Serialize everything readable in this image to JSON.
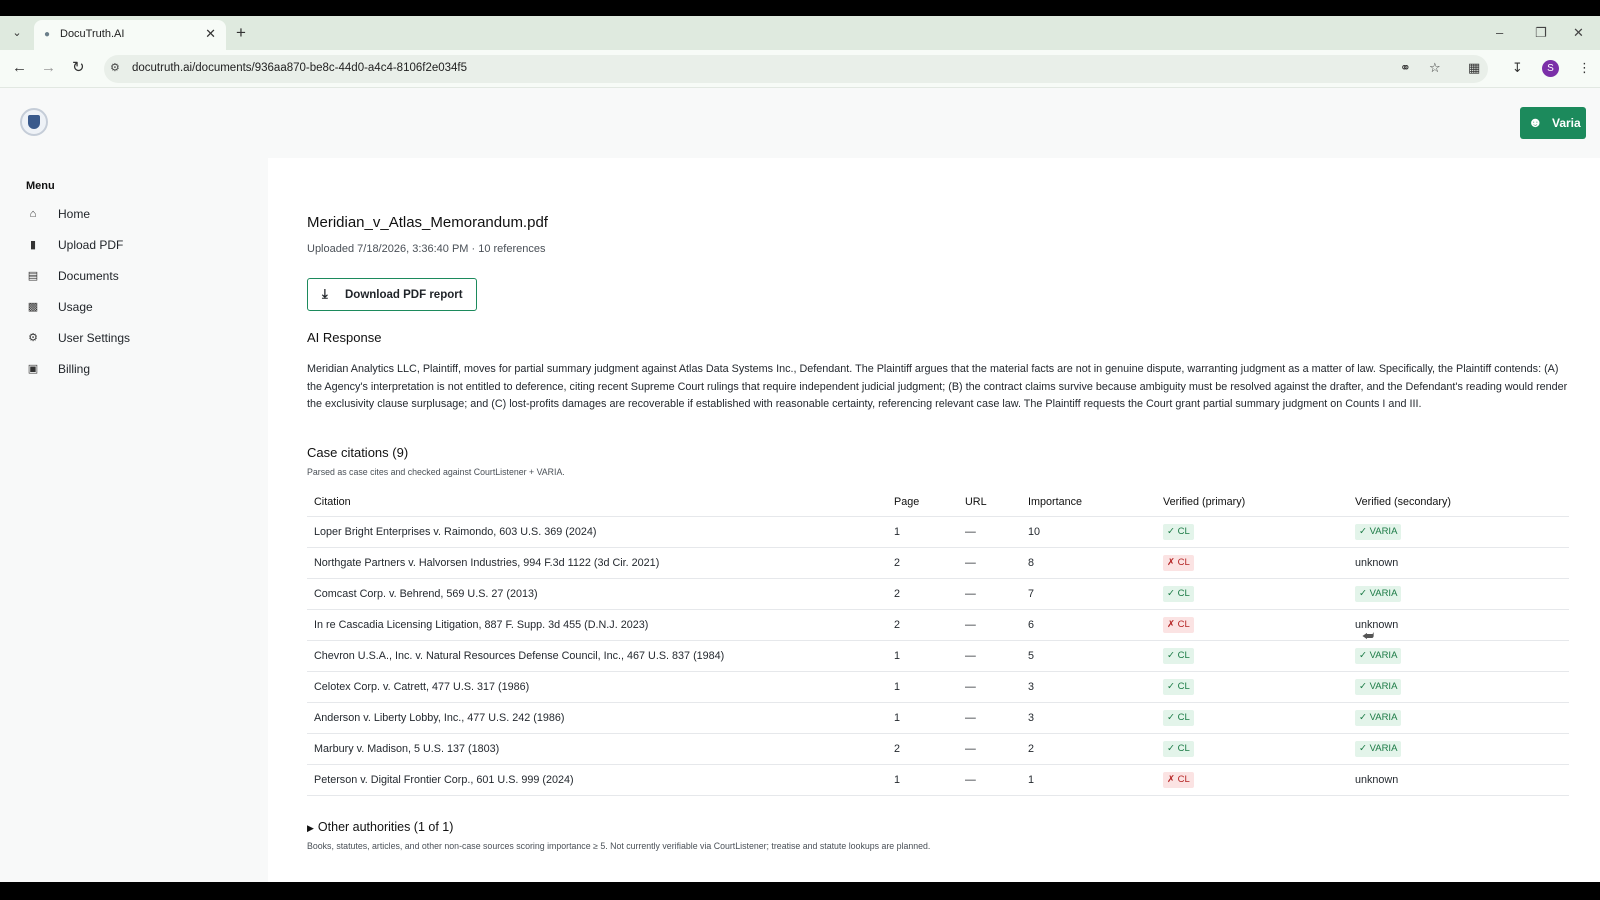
{
  "browser": {
    "tab_title": "DocuTruth.AI",
    "url": "docutruth.ai/documents/936aa870-be8c-44d0-a4c4-8106f2e034f5",
    "profile_initial": "S"
  },
  "header": {
    "user_button_label": "Varia"
  },
  "sidebar": {
    "menu_title": "Menu",
    "items": [
      {
        "label": "Home",
        "icon": "home-icon"
      },
      {
        "label": "Upload PDF",
        "icon": "file-upload-icon"
      },
      {
        "label": "Documents",
        "icon": "documents-icon"
      },
      {
        "label": "Usage",
        "icon": "bar-chart-icon"
      },
      {
        "label": "User Settings",
        "icon": "gear-icon"
      },
      {
        "label": "Billing",
        "icon": "card-icon"
      }
    ]
  },
  "document": {
    "title": "Meridian_v_Atlas_Memorandum.pdf",
    "meta": "Uploaded 7/18/2026, 3:36:40 PM · 10 references",
    "download_label": "Download PDF report"
  },
  "ai_response": {
    "heading": "AI Response",
    "text": "Meridian Analytics LLC, Plaintiff, moves for partial summary judgment against Atlas Data Systems Inc., Defendant. The Plaintiff argues that the material facts are not in genuine dispute, warranting judgment as a matter of law. Specifically, the Plaintiff contends: (A) the Agency's interpretation is not entitled to deference, citing recent Supreme Court rulings that require independent judicial judgment; (B) the contract claims survive because ambiguity must be resolved against the drafter, and the Defendant's reading would render the exclusivity clause surplusage; and (C) lost-profits damages are recoverable if established with reasonable certainty, referencing relevant case law. The Plaintiff requests the Court grant partial summary judgment on Counts I and III."
  },
  "citations": {
    "heading": "Case citations (9)",
    "note": "Parsed as case cites and checked against CourtListener + VARIA.",
    "columns": [
      "Citation",
      "Page",
      "URL",
      "Importance",
      "Verified (primary)",
      "Verified (secondary)"
    ],
    "rows": [
      {
        "citation": "Loper Bright Enterprises v. Raimondo, 603 U.S. 369 (2024)",
        "page": "1",
        "url": "—",
        "importance": "10",
        "primary": "✓ CL",
        "primary_ok": true,
        "secondary": "✓ VARIA",
        "secondary_ok": true
      },
      {
        "citation": "Northgate Partners v. Halvorsen Industries, 994 F.3d 1122 (3d Cir. 2021)",
        "page": "2",
        "url": "—",
        "importance": "8",
        "primary": "✗ CL",
        "primary_ok": false,
        "secondary": "unknown",
        "secondary_ok": null
      },
      {
        "citation": "Comcast Corp. v. Behrend, 569 U.S. 27 (2013)",
        "page": "2",
        "url": "—",
        "importance": "7",
        "primary": "✓ CL",
        "primary_ok": true,
        "secondary": "✓ VARIA",
        "secondary_ok": true
      },
      {
        "citation": "In re Cascadia Licensing Litigation, 887 F. Supp. 3d 455 (D.N.J. 2023)",
        "page": "2",
        "url": "—",
        "importance": "6",
        "primary": "✗ CL",
        "primary_ok": false,
        "secondary": "unknown",
        "secondary_ok": null
      },
      {
        "citation": "Chevron U.S.A., Inc. v. Natural Resources Defense Council, Inc., 467 U.S. 837 (1984)",
        "page": "1",
        "url": "—",
        "importance": "5",
        "primary": "✓ CL",
        "primary_ok": true,
        "secondary": "✓ VARIA",
        "secondary_ok": true
      },
      {
        "citation": "Celotex Corp. v. Catrett, 477 U.S. 317 (1986)",
        "page": "1",
        "url": "—",
        "importance": "3",
        "primary": "✓ CL",
        "primary_ok": true,
        "secondary": "✓ VARIA",
        "secondary_ok": true
      },
      {
        "citation": "Anderson v. Liberty Lobby, Inc., 477 U.S. 242 (1986)",
        "page": "1",
        "url": "—",
        "importance": "3",
        "primary": "✓ CL",
        "primary_ok": true,
        "secondary": "✓ VARIA",
        "secondary_ok": true
      },
      {
        "citation": "Marbury v. Madison, 5 U.S. 137 (1803)",
        "page": "2",
        "url": "—",
        "importance": "2",
        "primary": "✓ CL",
        "primary_ok": true,
        "secondary": "✓ VARIA",
        "secondary_ok": true
      },
      {
        "citation": "Peterson v. Digital Frontier Corp., 601 U.S. 999 (2024)",
        "page": "1",
        "url": "—",
        "importance": "1",
        "primary": "✗ CL",
        "primary_ok": false,
        "secondary": "unknown",
        "secondary_ok": null
      }
    ]
  },
  "other_authorities": {
    "toggle_label": "Other authorities (1 of 1)",
    "note": "Books, statutes, articles, and other non-case sources scoring importance ≥ 5. Not currently verifiable via CourtListener; treatise and statute lookups are planned."
  },
  "colors": {
    "accent": "#1c8a5c",
    "ok_bg": "#e3f4ea",
    "ok_fg": "#1b7a45",
    "bad_bg": "#fbe3e3",
    "bad_fg": "#b42323"
  }
}
